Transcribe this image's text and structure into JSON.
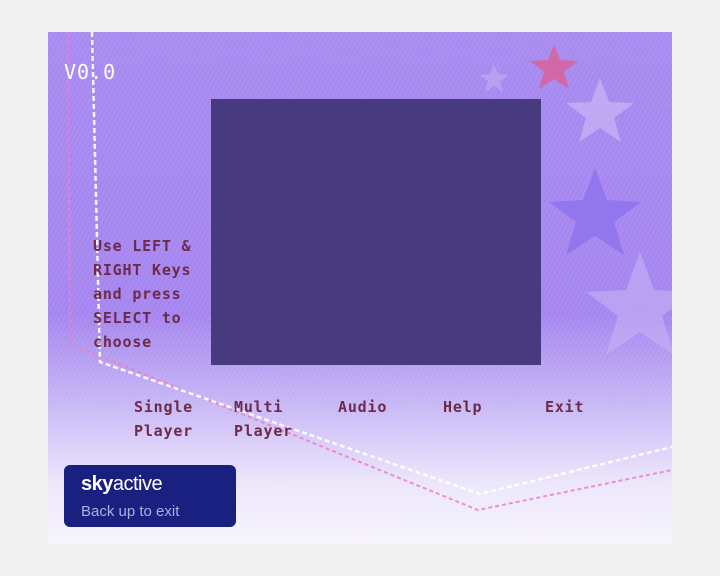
{
  "version": "V0.0",
  "instructions": "Use LEFT & RIGHT Keys and press SELECT to choose",
  "menu": [
    {
      "label": "Single\nPlayer"
    },
    {
      "label": "Multi\nPlayer"
    },
    {
      "label": "Audio"
    },
    {
      "label": "Help"
    },
    {
      "label": "Exit"
    }
  ],
  "sky": {
    "logo_bold": "sky",
    "logo_light": "active",
    "back_text": "Back up to exit"
  },
  "colors": {
    "background": "#a585ef",
    "preview": "#483a7e",
    "text": "#6d2a4a",
    "sky_panel": "#1a2080"
  }
}
